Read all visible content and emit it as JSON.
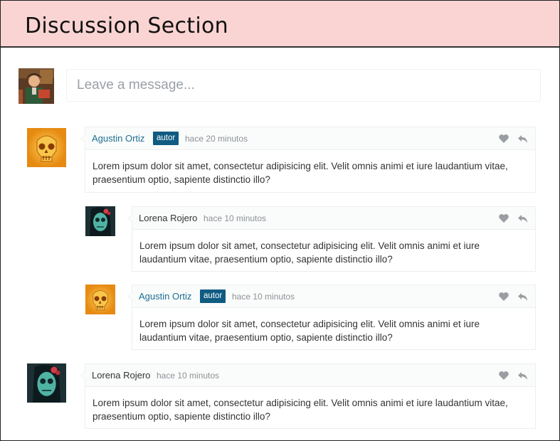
{
  "header": {
    "title": "Discussion Section"
  },
  "compose": {
    "placeholder": "Leave a message..."
  },
  "author_badge": "autor",
  "comments": [
    {
      "name": "Agustin Ortiz",
      "time": "hace 20 minutos",
      "is_author": true,
      "text": "Lorem ipsum dolor sit amet, consectetur adipisicing elit. Velit omnis animi et iure laudantium vitae, praesentium optio, sapiente distinctio illo?"
    },
    {
      "name": "Lorena Rojero",
      "time": "hace 10 minutos",
      "is_author": false,
      "text": "Lorem ipsum dolor sit amet, consectetur adipisicing elit. Velit omnis animi et iure laudantium vitae, praesentium optio, sapiente distinctio illo?"
    },
    {
      "name": "Agustin Ortiz",
      "time": "hace 10 minutos",
      "is_author": true,
      "text": "Lorem ipsum dolor sit amet, consectetur adipisicing elit. Velit omnis animi et iure laudantium vitae, praesentium optio, sapiente distinctio illo?"
    },
    {
      "name": "Lorena Rojero",
      "time": "hace 10 minutos",
      "is_author": false,
      "text": "Lorem ipsum dolor sit amet, consectetur adipisicing elit. Velit omnis animi et iure laudantium vitae, praesentium optio, sapiente distinctio illo?"
    }
  ],
  "icons": {
    "like": "heart-icon",
    "reply": "reply-icon"
  },
  "colors": {
    "header_bg": "#f9d4d2",
    "author_name": "#1d6f92",
    "badge_bg": "#0f5b82",
    "muted": "#8c9296"
  }
}
